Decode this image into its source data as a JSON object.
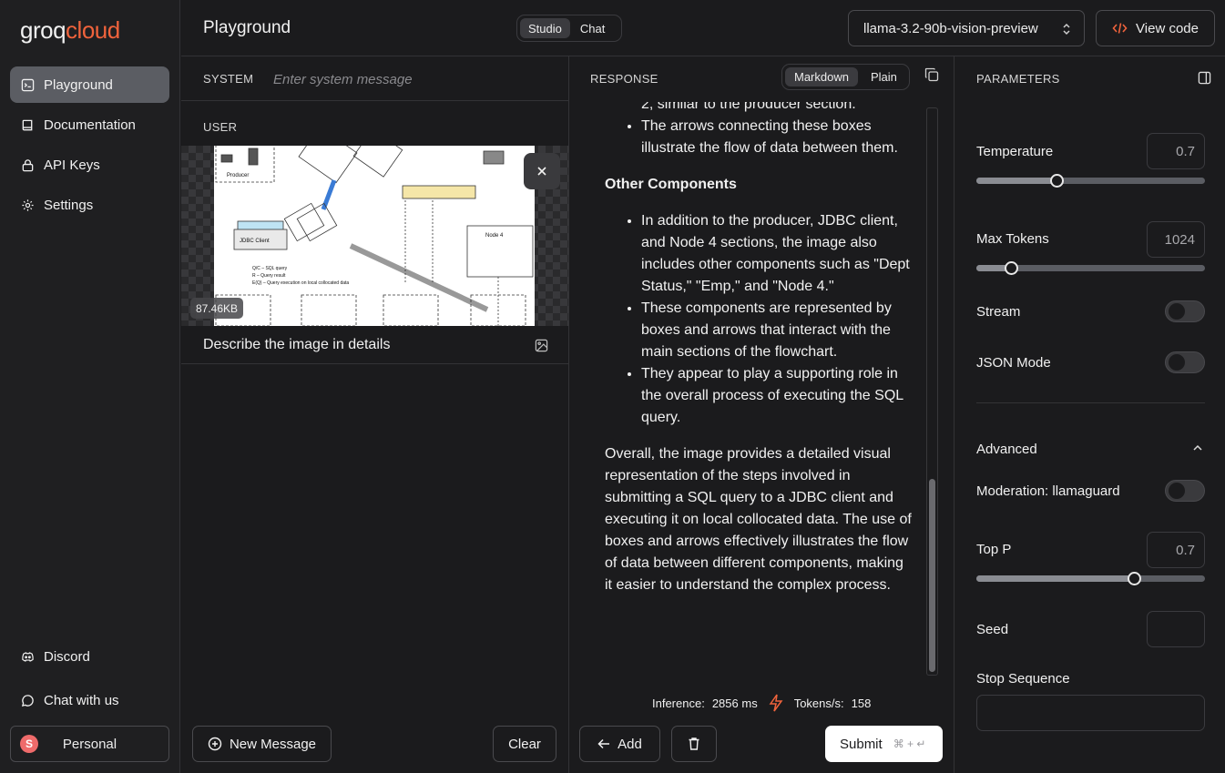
{
  "brand": {
    "part1": "groq",
    "part2": "cloud"
  },
  "sidebar": {
    "items": [
      {
        "label": "Playground",
        "icon": "playground-icon"
      },
      {
        "label": "Documentation",
        "icon": "book-icon"
      },
      {
        "label": "API Keys",
        "icon": "lock-icon"
      },
      {
        "label": "Settings",
        "icon": "gear-icon"
      }
    ],
    "bottom": [
      {
        "label": "Discord",
        "icon": "discord-icon"
      },
      {
        "label": "Chat with us",
        "icon": "chat-icon"
      }
    ],
    "account": {
      "initial": "S",
      "label": "Personal"
    }
  },
  "header": {
    "title": "Playground",
    "modes": [
      "Studio",
      "Chat"
    ],
    "active_mode": "Studio",
    "model": "llama-3.2-90b-vision-preview",
    "view_code": "View code"
  },
  "messages": {
    "system_label": "SYSTEM",
    "system_placeholder": "Enter system message",
    "user_label": "USER",
    "image_size": "87.46KB",
    "user_text": "Describe the image in details",
    "new_message": "New Message",
    "clear": "Clear"
  },
  "response": {
    "label": "RESPONSE",
    "formats": [
      "Markdown",
      "Plain"
    ],
    "active_format": "Markdown",
    "partial_line": "2, similar to the producer section.",
    "bullets_top": [
      "The arrows connecting these boxes illustrate the flow of data between them."
    ],
    "heading": "Other Components",
    "bullets": [
      "In addition to the producer, JDBC client, and Node 4 sections, the image also includes other components such as \"Dept Status,\" \"Emp,\" and \"Node 4.\"",
      "These components are represented by boxes and arrows that interact with the main sections of the flowchart.",
      "They appear to play a supporting role in the overall process of executing the SQL query."
    ],
    "summary": "Overall, the image provides a detailed visual representation of the steps involved in submitting a SQL query to a JDBC client and executing it on local collocated data. The use of boxes and arrows effectively illustrates the flow of data between different components, making it easier to understand the complex process.",
    "inference_label": "Inference:",
    "inference_value": "2856 ms",
    "tokens_label": "Tokens/s:",
    "tokens_value": "158",
    "add": "Add",
    "submit": "Submit",
    "submit_shortcut": "⌘ + ↵"
  },
  "parameters": {
    "label": "PARAMETERS",
    "temperature": {
      "label": "Temperature",
      "value": "0.7",
      "fraction": 0.35
    },
    "max_tokens": {
      "label": "Max Tokens",
      "value": "1024",
      "fraction": 0.15
    },
    "stream": {
      "label": "Stream",
      "on": false
    },
    "json_mode": {
      "label": "JSON Mode",
      "on": false
    },
    "advanced": "Advanced",
    "moderation": {
      "label": "Moderation: llamaguard",
      "on": false
    },
    "top_p": {
      "label": "Top P",
      "value": "0.7",
      "fraction": 0.69
    },
    "seed": {
      "label": "Seed",
      "value": ""
    },
    "stop_sequence": {
      "label": "Stop Sequence",
      "value": ""
    }
  },
  "colors": {
    "accent": "#f0633c",
    "submit_bg": "#ffffff",
    "active_nav": "#5b5d63"
  }
}
